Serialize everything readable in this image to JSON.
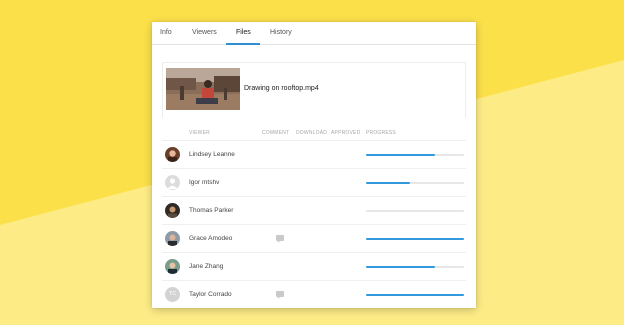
{
  "tabs": [
    {
      "label": "Info",
      "active": false
    },
    {
      "label": "Viewers",
      "active": false
    },
    {
      "label": "Files",
      "active": true
    },
    {
      "label": "History",
      "active": false
    }
  ],
  "file": {
    "name": "Drawing on rooftop.mp4"
  },
  "columns": {
    "viewer": "VIEWER",
    "comment": "COMMENT",
    "download": "DOWNLOAD",
    "approved": "APPROVED",
    "progress": "PROGRESS"
  },
  "viewers": [
    {
      "name": "Lindsey Leanne",
      "avatar": "photo",
      "comment": false,
      "progress": 0.7
    },
    {
      "name": "Igor mtshv",
      "avatar": "placeholder",
      "comment": false,
      "progress": 0.45
    },
    {
      "name": "Thomas Parker",
      "avatar": "photo",
      "comment": false,
      "progress": 0.0
    },
    {
      "name": "Grace Amodeo",
      "avatar": "photo",
      "comment": true,
      "progress": 1.0
    },
    {
      "name": "Jane Zhang",
      "avatar": "photo",
      "comment": false,
      "progress": 0.7
    },
    {
      "name": "Taylor Corrado",
      "avatar": "initials",
      "initials": "TC",
      "comment": true,
      "progress": 1.0
    }
  ],
  "colors": {
    "background": "#fbe04a",
    "background_light": "#fdec86",
    "accent": "#2f8fd0",
    "progress": "#3399dd"
  }
}
